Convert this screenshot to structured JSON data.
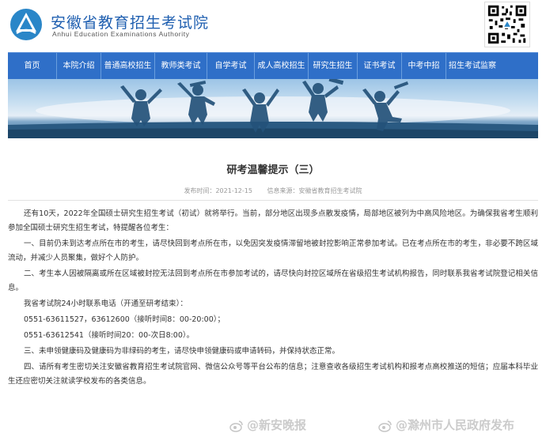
{
  "header": {
    "title": "安徽省教育招生考试院",
    "subtitle": "Anhui Education Examinations Authority"
  },
  "nav": {
    "items": [
      "首页",
      "本院介绍",
      "普通高校招生",
      "教师类考试",
      "自学考试",
      "成人高校招生",
      "研究生招生",
      "证书考试",
      "中考中招",
      "招生考试监察"
    ]
  },
  "article": {
    "title": "研考温馨提示（三）",
    "date": "发布时间：2021-12-15",
    "source": "信息来源：安徽省教育招生考试院",
    "paragraphs": [
      "还有10天，2022年全国硕士研究生招生考试（初试）就将举行。当前，部分地区出现多点散发疫情，局部地区被列为中高风险地区。为确保我省考生顺利参加全国硕士研究生招生考试，特提醒各位考生：",
      "一、目前仍未到达考点所在市的考生，请尽快回到考点所在市，以免因突发疫情滞留地被封控影响正常参加考试。已在考点所在市的考生，非必要不跨区域流动，并减少人员聚集，做好个人防护。",
      "二、考生本人因被隔离或所在区域被封控无法回到考点所在市参加考试的，请尽快向封控区域所在省级招生考试机构报告，同时联系我省考试院登记相关信息。",
      "我省考试院24小时联系电话（开通至研考结束）：",
      "0551-63611527，63612600（接听时间8：00-20:00）；",
      "0551-63612541（接听时间20：00-次日8:00）。",
      "三、未申领健康码及健康码为非绿码的考生，请尽快申领健康码或申请转码，并保持状态正常。",
      "四、请所有考生密切关注安徽省教育招生考试院官网、微信公众号等平台公布的信息；注意查收各级招生考试机构和报考点高校推送的短信；应届本科毕业生还应密切关注就读学校发布的各类信息。"
    ]
  },
  "watermarks": {
    "left": "@新安晚报",
    "right": "@滁州市人民政府发布"
  },
  "colors": {
    "brand": "#1f5fb0",
    "nav_bg": "#2f6fc8"
  }
}
